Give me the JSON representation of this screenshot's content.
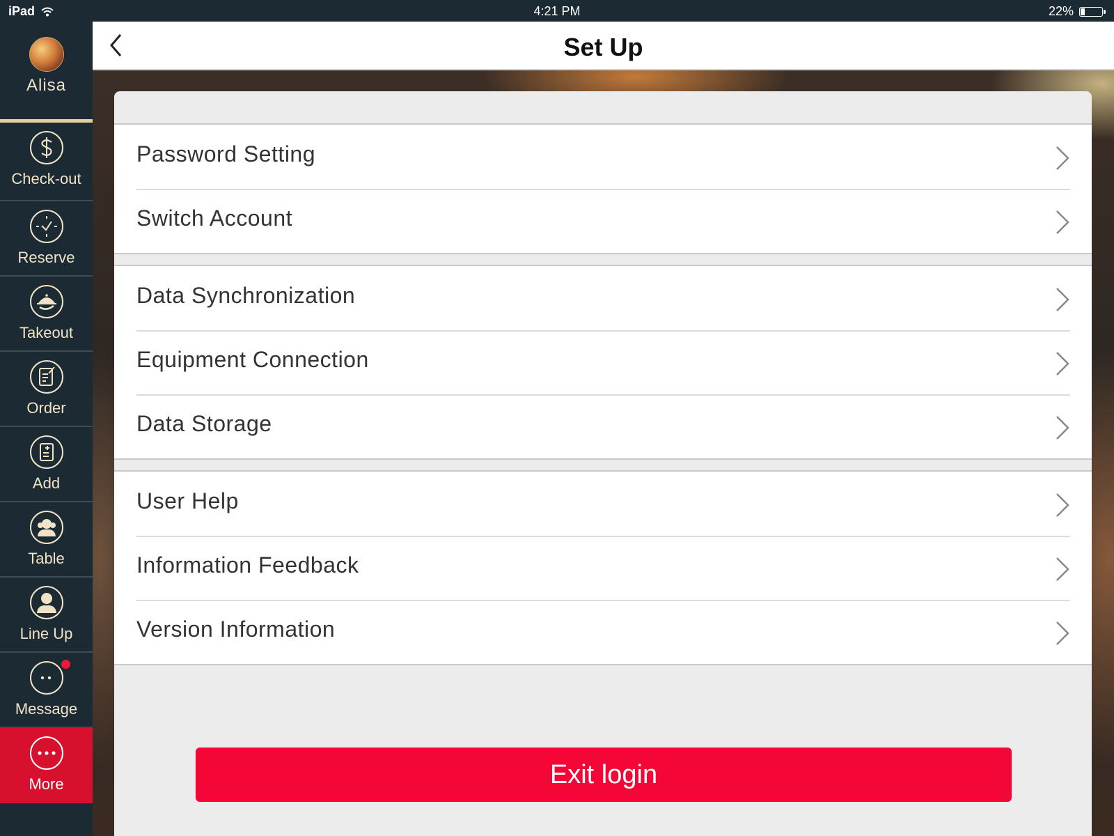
{
  "status_bar": {
    "device": "iPad",
    "time": "4:21 PM",
    "battery": "22%",
    "battery_level": 0.22
  },
  "profile": {
    "name": "Alisa"
  },
  "sidebar": {
    "items": [
      {
        "label": "Check-out",
        "icon": "dollar-icon"
      },
      {
        "label": "Reserve",
        "icon": "clock-icon"
      },
      {
        "label": "Takeout",
        "icon": "cloche-icon"
      },
      {
        "label": "Order",
        "icon": "order-icon"
      },
      {
        "label": "Add",
        "icon": "add-document-icon"
      },
      {
        "label": "Table",
        "icon": "table-people-icon"
      },
      {
        "label": "Line Up",
        "icon": "person-icon"
      },
      {
        "label": "Message",
        "icon": "chat-icon",
        "unread": true
      },
      {
        "label": "More",
        "icon": "more-icon",
        "active": true
      }
    ]
  },
  "header": {
    "title": "Set Up"
  },
  "settings": {
    "groups": [
      {
        "items": [
          "Password Setting",
          "Switch Account"
        ]
      },
      {
        "items": [
          "Data Synchronization",
          "Equipment Connection",
          "Data Storage"
        ]
      },
      {
        "items": [
          "User Help",
          "Information Feedback",
          "Version Information"
        ]
      }
    ]
  },
  "exit_button": {
    "label": "Exit login"
  },
  "colors": {
    "accent": "#f40636",
    "active_nav": "#d7102e",
    "sidebar_bg": "#1b2a33",
    "sidebar_text": "#f1e4c6"
  }
}
